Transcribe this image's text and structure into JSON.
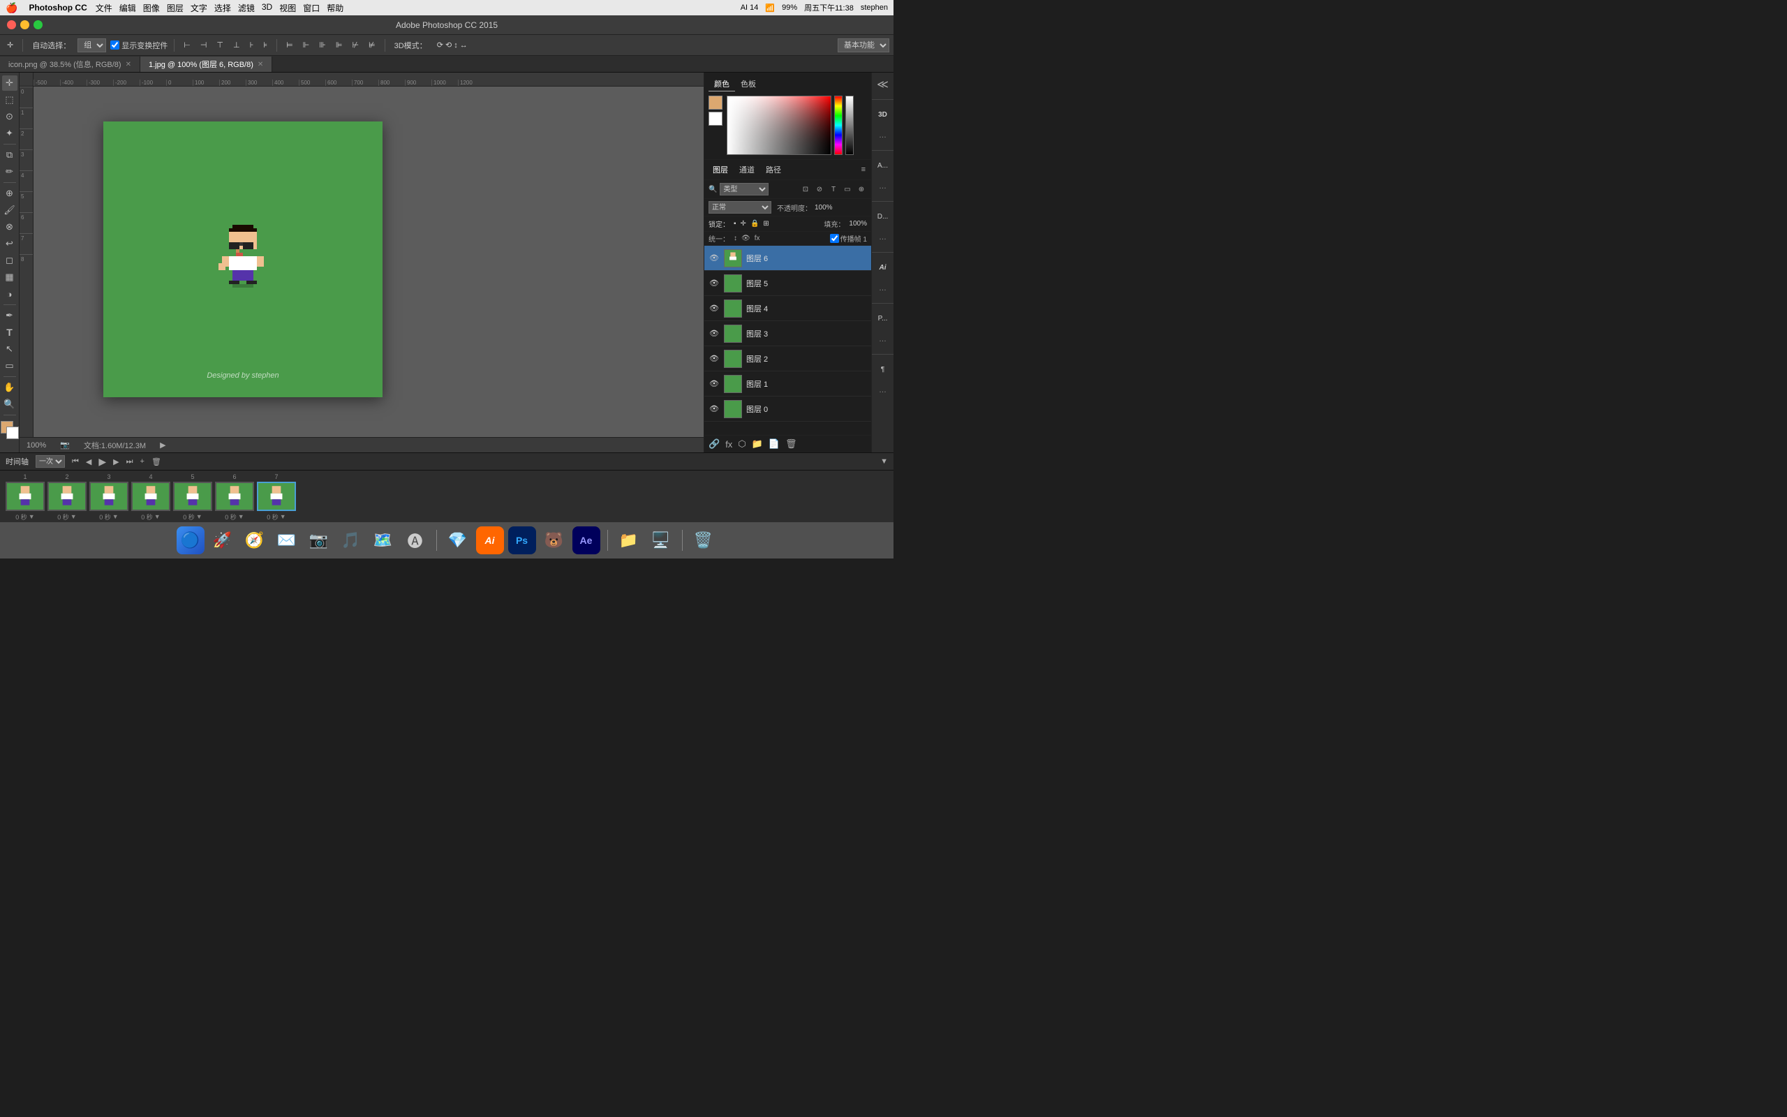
{
  "app": {
    "title": "Adobe Photoshop CC 2015",
    "version": "CC"
  },
  "menubar": {
    "apple": "⌘",
    "app_name": "Photoshop CC",
    "menus": [
      "文件",
      "编辑",
      "图像",
      "图层",
      "文字",
      "选择",
      "滤镜",
      "3D",
      "视图",
      "窗口",
      "帮助"
    ],
    "right": {
      "battery": "AI 14",
      "wifi": "99%",
      "time": "周五下午11:38",
      "user": "stephen"
    }
  },
  "toolbar": {
    "auto_select_label": "自动选择：",
    "auto_select_value": "组",
    "show_transform": "显示变换控件",
    "mode_3d": "3D模式：",
    "basic_func": "基本功能"
  },
  "tabs": [
    {
      "id": "tab1",
      "label": "icon.png @ 38.5% (信息, RGB/8)",
      "active": false,
      "modified": false
    },
    {
      "id": "tab2",
      "label": "1.jpg @ 100% (图层 6, RGB/8)",
      "active": true,
      "modified": true
    }
  ],
  "canvas": {
    "zoom": "100%",
    "doc_info": "文档:1.60M/12.3M",
    "canvas_text": "Designed by stephen",
    "bg_color": "#4a9b4a"
  },
  "tools": {
    "items": [
      {
        "id": "move",
        "icon": "✛",
        "label": "移动工具"
      },
      {
        "id": "select-rect",
        "icon": "⬜",
        "label": "矩形选框"
      },
      {
        "id": "lasso",
        "icon": "⊙",
        "label": "套索工具"
      },
      {
        "id": "wand",
        "icon": "✦",
        "label": "魔棒工具"
      },
      {
        "id": "crop",
        "icon": "⧉",
        "label": "裁剪工具"
      },
      {
        "id": "eyedropper",
        "icon": "✏",
        "label": "吸管工具"
      },
      {
        "id": "heal",
        "icon": "⊕",
        "label": "修复工具"
      },
      {
        "id": "brush",
        "icon": "🖌",
        "label": "画笔工具"
      },
      {
        "id": "clone",
        "icon": "⊗",
        "label": "仿制图章"
      },
      {
        "id": "history",
        "icon": "↩",
        "label": "历史记录"
      },
      {
        "id": "eraser",
        "icon": "◻",
        "label": "橡皮擦"
      },
      {
        "id": "gradient",
        "icon": "▦",
        "label": "渐变工具"
      },
      {
        "id": "dodge",
        "icon": "◑",
        "label": "减淡工具"
      },
      {
        "id": "pen",
        "icon": "✒",
        "label": "钢笔工具"
      },
      {
        "id": "text",
        "icon": "T",
        "label": "文字工具"
      },
      {
        "id": "path-select",
        "icon": "↖",
        "label": "路径选择"
      },
      {
        "id": "shape",
        "icon": "▭",
        "label": "形状工具"
      },
      {
        "id": "hand",
        "icon": "✋",
        "label": "抓手工具"
      },
      {
        "id": "zoom",
        "icon": "🔍",
        "label": "缩放工具"
      }
    ]
  },
  "color_panel": {
    "tabs": [
      "颜色",
      "色板"
    ],
    "active_tab": "颜色",
    "fg_color": "#dca870",
    "bg_color": "#ffffff"
  },
  "layers_panel": {
    "tabs": [
      "图层",
      "通道",
      "路径"
    ],
    "active_tab": "图层",
    "filter_label": "类型",
    "blend_mode": "正常",
    "opacity": "100%",
    "fill": "100%",
    "lock_label": "锁定：",
    "propagate_label": "传播帧 1",
    "unify_label": "统一：",
    "layers": [
      {
        "id": 6,
        "name": "图层 6",
        "visible": true,
        "active": true
      },
      {
        "id": 5,
        "name": "图层 5",
        "visible": true,
        "active": false
      },
      {
        "id": 4,
        "name": "图层 4",
        "visible": true,
        "active": false
      },
      {
        "id": 3,
        "name": "图层 3",
        "visible": true,
        "active": false
      },
      {
        "id": 2,
        "name": "图层 2",
        "visible": true,
        "active": false
      },
      {
        "id": 1,
        "name": "图层 1",
        "visible": true,
        "active": false
      },
      {
        "id": 0,
        "name": "图层 0",
        "visible": true,
        "active": false
      }
    ]
  },
  "mini_panels": {
    "items": [
      {
        "id": "3d",
        "label": "3D"
      },
      {
        "id": "actions",
        "label": "A..."
      },
      {
        "id": "effects",
        "label": "D..."
      },
      {
        "id": "history2",
        "label": "..."
      },
      {
        "id": "ai",
        "label": "Ai"
      },
      {
        "id": "para",
        "label": "P..."
      },
      {
        "id": "char",
        "label": "..."
      }
    ]
  },
  "timeline": {
    "title": "时间轴",
    "loop_label": "一次",
    "frames": [
      {
        "number": 1,
        "time": "0 秒",
        "active": false
      },
      {
        "number": 2,
        "time": "0 秒",
        "active": false
      },
      {
        "number": 3,
        "time": "0 秒",
        "active": false
      },
      {
        "number": 4,
        "time": "0 秒",
        "active": false
      },
      {
        "number": 5,
        "time": "0 秒",
        "active": false
      },
      {
        "number": 6,
        "time": "0 秒",
        "active": false
      },
      {
        "number": 7,
        "time": "0 秒",
        "active": true
      }
    ],
    "controls": {
      "loop": "一次",
      "play": "▶",
      "first": "⏮",
      "prev": "◀",
      "next": "▶",
      "last": "⏭"
    }
  },
  "dock": {
    "items": [
      {
        "id": "finder",
        "icon": "🔵",
        "label": "Finder"
      },
      {
        "id": "launchpad",
        "icon": "🚀",
        "label": "Launchpad"
      },
      {
        "id": "safari",
        "icon": "🧭",
        "label": "Safari"
      },
      {
        "id": "mail",
        "icon": "✉",
        "label": "Mail"
      },
      {
        "id": "photos",
        "icon": "📷",
        "label": "Photos"
      },
      {
        "id": "itunes",
        "icon": "🎵",
        "label": "iTunes"
      },
      {
        "id": "maps",
        "icon": "🗺",
        "label": "Maps"
      },
      {
        "id": "appstore",
        "icon": "🅐",
        "label": "App Store"
      },
      {
        "id": "sketch",
        "icon": "💎",
        "label": "Sketch"
      },
      {
        "id": "illustrator",
        "icon": "Ai",
        "label": "Illustrator"
      },
      {
        "id": "photoshop",
        "icon": "Ps",
        "label": "Photoshop"
      },
      {
        "id": "bear",
        "icon": "🐻",
        "label": "Bear"
      },
      {
        "id": "ae",
        "icon": "Ae",
        "label": "After Effects"
      },
      {
        "id": "files",
        "icon": "📁",
        "label": "Files"
      },
      {
        "id": "finder2",
        "icon": "🖥",
        "label": "Finder"
      },
      {
        "id": "trash",
        "icon": "🗑",
        "label": "Trash"
      }
    ]
  },
  "status": {
    "zoom": "100%",
    "doc_info": "文档:1.60M/12.3M"
  }
}
